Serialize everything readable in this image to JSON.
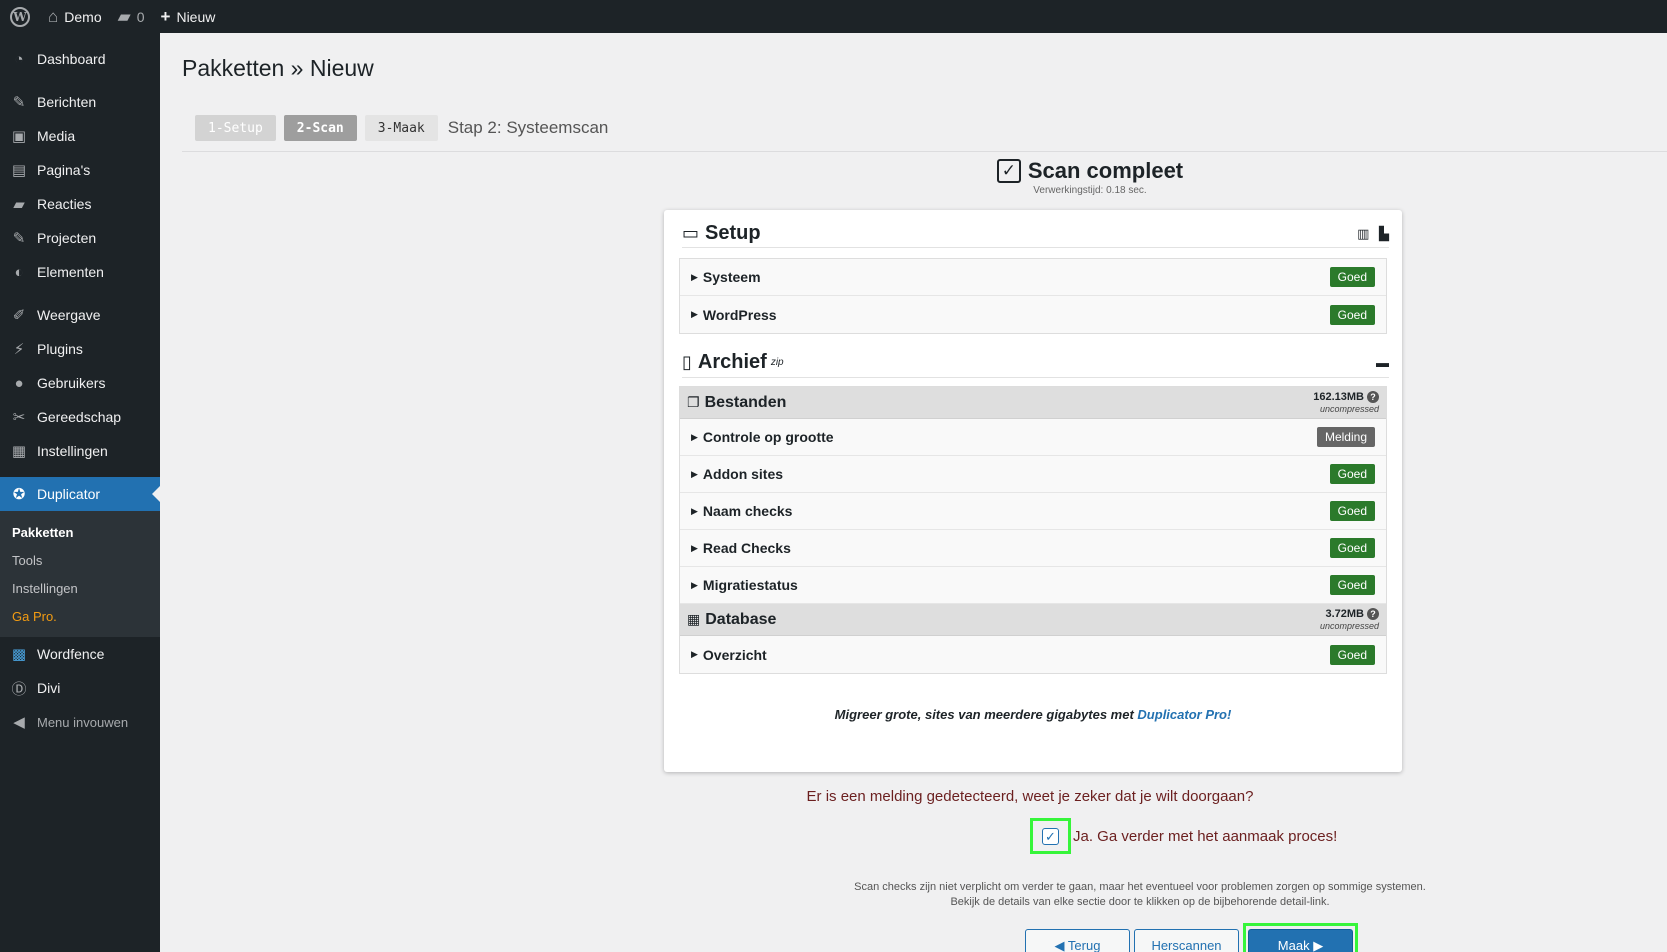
{
  "adminbar": {
    "site_name": "Demo",
    "comments_count": "0",
    "new_label": "Nieuw"
  },
  "sidebar": {
    "items": [
      {
        "label": "Dashboard",
        "icon": "dashboard-icon"
      },
      {
        "label": "Berichten",
        "icon": "pin-icon"
      },
      {
        "label": "Media",
        "icon": "media-icon"
      },
      {
        "label": "Pagina's",
        "icon": "page-icon"
      },
      {
        "label": "Reacties",
        "icon": "comment-icon"
      },
      {
        "label": "Projecten",
        "icon": "pin-icon"
      },
      {
        "label": "Elementen",
        "icon": "elements-icon"
      },
      {
        "label": "Weergave",
        "icon": "brush-icon"
      },
      {
        "label": "Plugins",
        "icon": "plugin-icon"
      },
      {
        "label": "Gebruikers",
        "icon": "user-icon"
      },
      {
        "label": "Gereedschap",
        "icon": "wrench-icon"
      },
      {
        "label": "Instellingen",
        "icon": "settings-icon"
      },
      {
        "label": "Duplicator",
        "icon": "duplicator-icon"
      },
      {
        "label": "Wordfence",
        "icon": "wordfence-icon"
      },
      {
        "label": "Divi",
        "icon": "divi-icon"
      },
      {
        "label": "Menu invouwen",
        "icon": "collapse-icon"
      }
    ],
    "submenu": {
      "pakketten": "Pakketten",
      "tools": "Tools",
      "instellingen": "Instellingen",
      "ga_pro": "Ga Pro."
    }
  },
  "page": {
    "title": "Pakketten » Nieuw",
    "steps": [
      "1-Setup",
      "2-Scan",
      "3-Maak"
    ],
    "step_title": "Stap 2: Systeemscan",
    "scan_title": "Scan compleet",
    "scan_time": "Verwerkingstijd: 0.18 sec."
  },
  "setup": {
    "title": "Setup",
    "rows": [
      {
        "label": "Systeem",
        "status": "Goed"
      },
      {
        "label": "WordPress",
        "status": "Goed"
      }
    ]
  },
  "archive": {
    "title": "Archief",
    "format": "zip",
    "files": {
      "title": "Bestanden",
      "size": "162.13MB",
      "size_note": "uncompressed",
      "rows": [
        {
          "label": "Controle op grootte",
          "status": "Melding"
        },
        {
          "label": "Addon sites",
          "status": "Goed"
        },
        {
          "label": "Naam checks",
          "status": "Goed"
        },
        {
          "label": "Read Checks",
          "status": "Goed"
        },
        {
          "label": "Migratiestatus",
          "status": "Goed"
        }
      ]
    },
    "database": {
      "title": "Database",
      "size": "3.72MB",
      "size_note": "uncompressed",
      "rows": [
        {
          "label": "Overzicht",
          "status": "Goed"
        }
      ]
    }
  },
  "promo": {
    "text": "Migreer grote, sites van meerdere gigabytes met",
    "link": "Duplicator Pro!"
  },
  "warning": {
    "question": "Er is een melding gedetecteerd, weet je zeker dat je wilt doorgaan?",
    "confirm": "Ja. Ga verder met het aanmaak proces!",
    "note_line1": "Scan checks zijn niet verplicht om verder te gaan, maar het eventueel voor problemen zorgen op sommige systemen.",
    "note_line2": "Bekijk de details van elke sectie door te klikken op de bijbehorende detail-link."
  },
  "buttons": {
    "back": "◀ Terug",
    "rescan": "Herscannen",
    "build": "Maak ▶"
  },
  "colors": {
    "sidebar_bg": "#1d2327",
    "accent": "#2271b1",
    "good": "#2b7a2b",
    "highlight": "#36f53a"
  }
}
